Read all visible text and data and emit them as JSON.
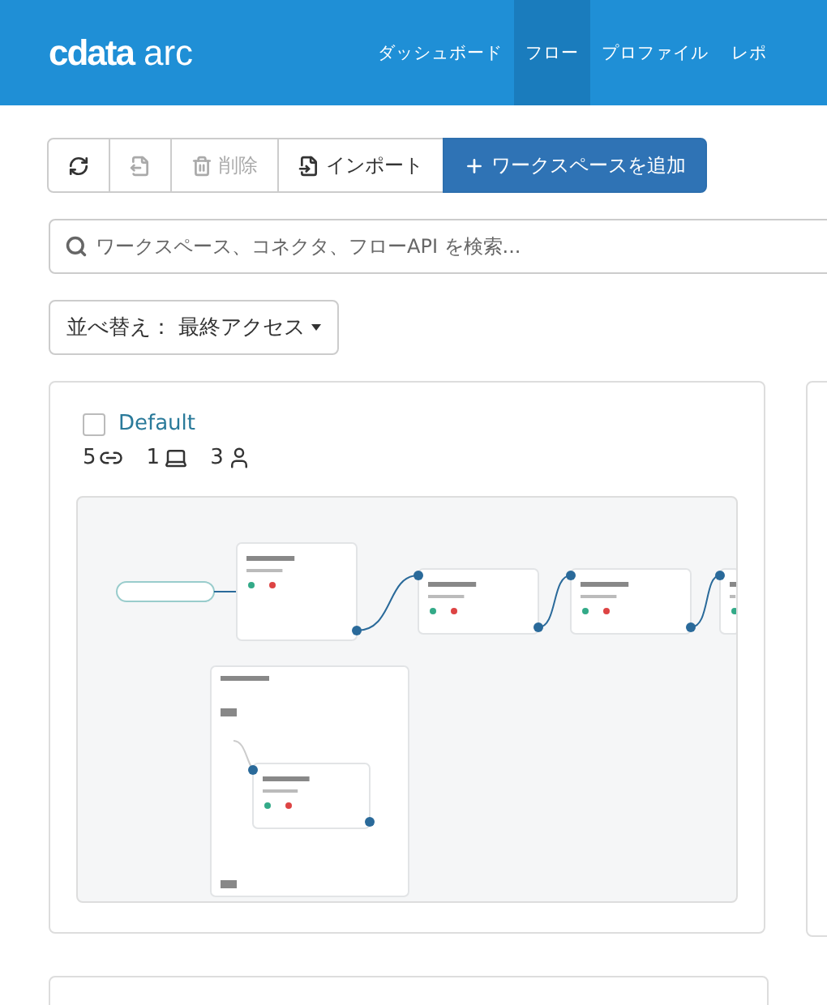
{
  "header": {
    "logo_mark": "cdata",
    "product": "arc",
    "nav": [
      {
        "label": "ダッシュボード",
        "selected": false
      },
      {
        "label": "フロー",
        "selected": true
      },
      {
        "label": "プロファイル",
        "selected": false
      },
      {
        "label": "レポ",
        "selected": false
      }
    ]
  },
  "toolbar": [
    {
      "kind": "refresh",
      "disabled": false
    },
    {
      "kind": "export",
      "disabled": true
    },
    {
      "kind": "delete",
      "label": "削除",
      "disabled": true
    },
    {
      "kind": "import",
      "label": "インポート",
      "disabled": false
    },
    {
      "kind": "add",
      "label": "ワークスペースを追加",
      "disabled": false
    }
  ],
  "search": {
    "placeholder": "ワークスペース、コネクタ、フローAPI を検索..."
  },
  "sort": {
    "label": "並べ替え： 最終アクセス"
  },
  "workspaces": [
    {
      "name": "Default",
      "checked": false,
      "connections": "5",
      "flows": "1",
      "users": "3"
    }
  ]
}
